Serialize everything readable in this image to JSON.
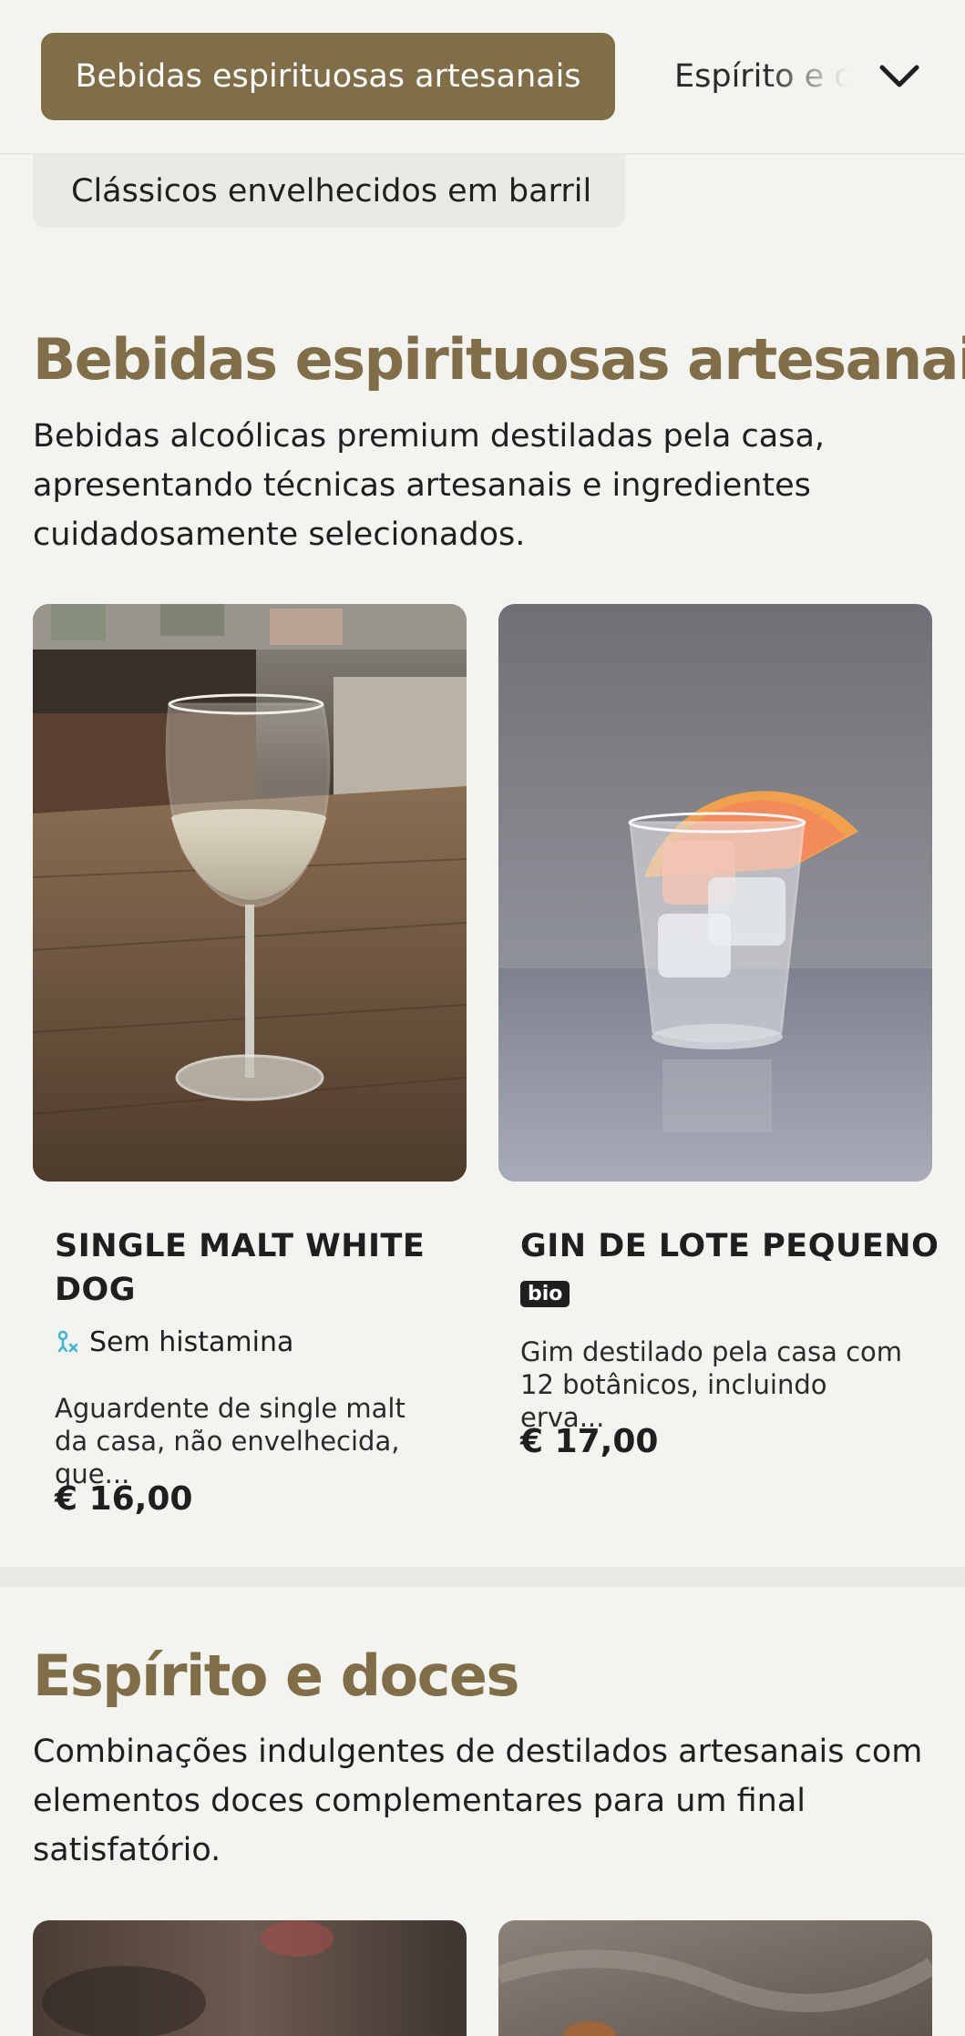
{
  "nav": {
    "active_category": "Bebidas espirituosas artesanais",
    "next_category": "Espírito e doces",
    "subcategory": "Clássicos envelhecidos em barril"
  },
  "sections": [
    {
      "title": "Bebidas espirituosas artesanais",
      "description": "Bebidas alcoólicas premium destiladas pela casa, apresentando técnicas artesanais e ingredientes cuidadosamente selecionados.",
      "products": [
        {
          "name_line1": "SINGLE MALT WHITE",
          "name_line2": "DOG",
          "tag": "Sem histamina",
          "description": "Aguardente de single malt da casa, não envelhecida, que...",
          "price": "€ 16,00"
        },
        {
          "name": "GIN DE LOTE PEQUENO",
          "badge": "bio",
          "description": "Gim destilado pela casa com 12 botânicos, incluindo erva...",
          "price": "€ 17,00"
        }
      ]
    },
    {
      "title": "Espírito e doces",
      "description": "Combinações indulgentes de destilados artesanais com elementos doces complementares para um final satisfatório."
    }
  ],
  "colors": {
    "accent": "#806e48",
    "background": "#f3f3ef",
    "tag_icon": "#38b6d8"
  },
  "icons": {
    "dropdown": "chevron-down-icon",
    "tag": "histamine-free-icon"
  }
}
